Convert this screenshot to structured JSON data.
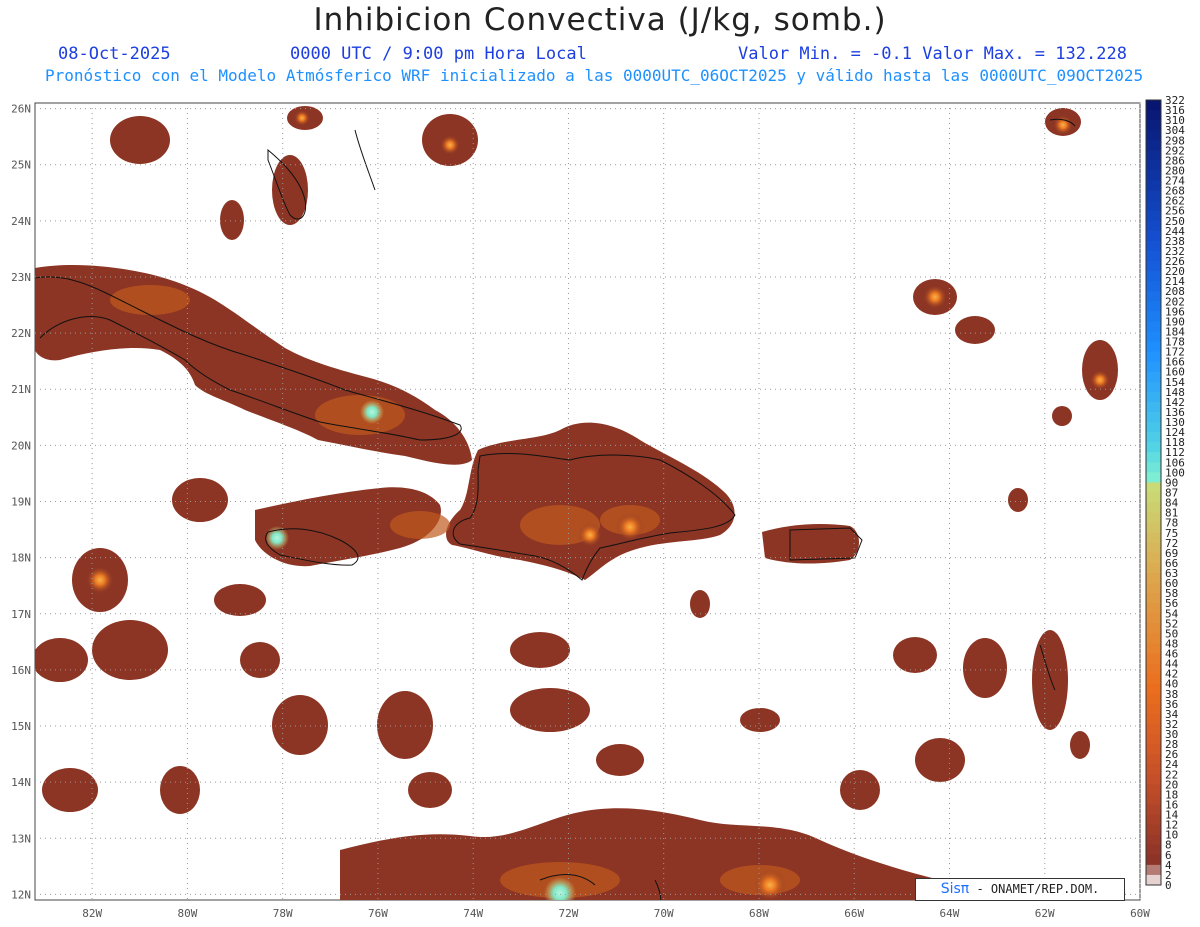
{
  "header": {
    "title": "Inhibicion Convectiva (J/kg, somb.)",
    "date": "08-Oct-2025",
    "time": "0000 UTC / 9:00 pm Hora Local",
    "minmax": "Valor Min. = -0.1  Valor Max. = 132.228",
    "subtitle": "Pronóstico con el Modelo Atmósferico WRF inicializado a las 0000UTC_06OCT2025 y válido hasta las  0000UTC_09OCT2025"
  },
  "axes": {
    "lat_labels": [
      "26N",
      "25N",
      "24N",
      "23N",
      "22N",
      "21N",
      "20N",
      "19N",
      "18N",
      "17N",
      "16N",
      "15N",
      "14N",
      "13N",
      "12N"
    ],
    "lon_labels": [
      "82W",
      "80W",
      "78W",
      "76W",
      "74W",
      "72W",
      "70W",
      "68W",
      "66W",
      "64W",
      "62W",
      "60W"
    ],
    "lon_range": [
      -83.2,
      -60
    ],
    "lat_range": [
      11.9,
      26.1
    ],
    "grid": "dotted"
  },
  "colorbar": {
    "labels": [
      "322",
      "316",
      "310",
      "304",
      "298",
      "292",
      "286",
      "280",
      "274",
      "268",
      "262",
      "256",
      "250",
      "244",
      "238",
      "232",
      "226",
      "220",
      "214",
      "208",
      "202",
      "196",
      "190",
      "184",
      "178",
      "172",
      "166",
      "160",
      "154",
      "148",
      "142",
      "136",
      "130",
      "124",
      "118",
      "112",
      "106",
      "100",
      "90",
      "87",
      "84",
      "81",
      "78",
      "75",
      "72",
      "69",
      "66",
      "63",
      "60",
      "58",
      "56",
      "54",
      "52",
      "50",
      "48",
      "46",
      "44",
      "42",
      "40",
      "38",
      "36",
      "34",
      "32",
      "30",
      "28",
      "26",
      "24",
      "22",
      "20",
      "18",
      "16",
      "14",
      "12",
      "10",
      "8",
      "6",
      "4",
      "2",
      "0"
    ]
  },
  "colors": {
    "field_base": "#8c3524",
    "field_warm": "#d2641c",
    "field_hot": "#f07f1e",
    "field_peak": "#7fe8c8",
    "title_blue": "#1d3fe0",
    "subtitle_blue": "#1e90ff"
  },
  "credit": {
    "brand": "Sisπ",
    "text": " - ONAMET/REP.DOM."
  }
}
